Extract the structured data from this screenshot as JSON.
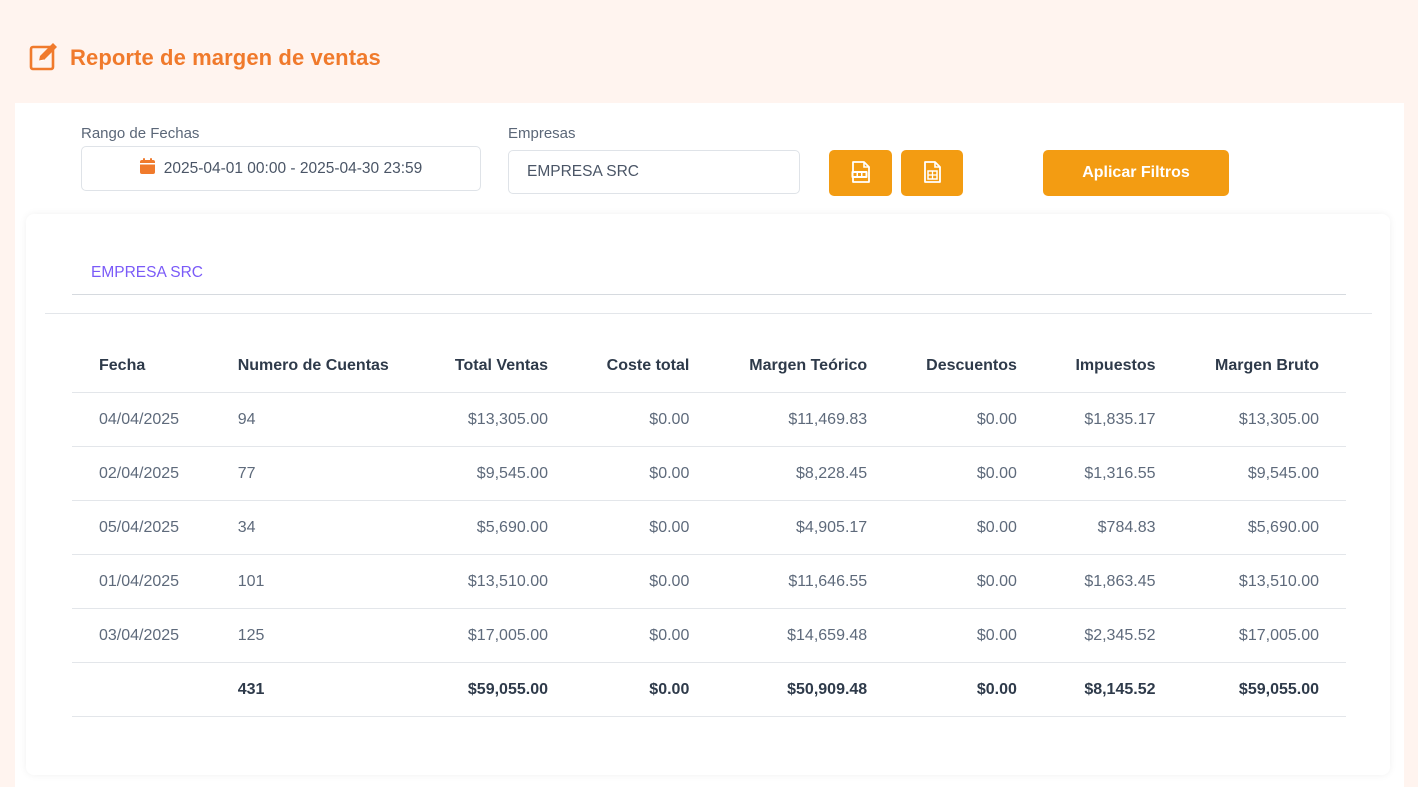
{
  "page": {
    "title": "Reporte de margen de ventas",
    "accent_color": "#f07a2c",
    "button_color": "#f39c12"
  },
  "filters": {
    "date_label": "Rango de Fechas",
    "date_range": "2025-04-01 00:00 - 2025-04-30 23:59",
    "company_label": "Empresas",
    "company_value": "EMPRESA SRC",
    "export_pdf_icon": "pdf-file-icon",
    "export_excel_icon": "excel-file-icon",
    "apply_label": "Aplicar Filtros"
  },
  "tabs": [
    {
      "label": "EMPRESA SRC",
      "active": true
    }
  ],
  "table": {
    "headers": [
      "Fecha",
      "Numero de Cuentas",
      "Total Ventas",
      "Coste total",
      "Margen Teórico",
      "Descuentos",
      "Impuestos",
      "Margen Bruto"
    ],
    "rows": [
      [
        "04/04/2025",
        "94",
        "$13,305.00",
        "$0.00",
        "$11,469.83",
        "$0.00",
        "$1,835.17",
        "$13,305.00"
      ],
      [
        "02/04/2025",
        "77",
        "$9,545.00",
        "$0.00",
        "$8,228.45",
        "$0.00",
        "$1,316.55",
        "$9,545.00"
      ],
      [
        "05/04/2025",
        "34",
        "$5,690.00",
        "$0.00",
        "$4,905.17",
        "$0.00",
        "$784.83",
        "$5,690.00"
      ],
      [
        "01/04/2025",
        "101",
        "$13,510.00",
        "$0.00",
        "$11,646.55",
        "$0.00",
        "$1,863.45",
        "$13,510.00"
      ],
      [
        "03/04/2025",
        "125",
        "$17,005.00",
        "$0.00",
        "$14,659.48",
        "$0.00",
        "$2,345.52",
        "$17,005.00"
      ]
    ],
    "totals": [
      "",
      "431",
      "$59,055.00",
      "$0.00",
      "$50,909.48",
      "$0.00",
      "$8,145.52",
      "$59,055.00"
    ]
  }
}
